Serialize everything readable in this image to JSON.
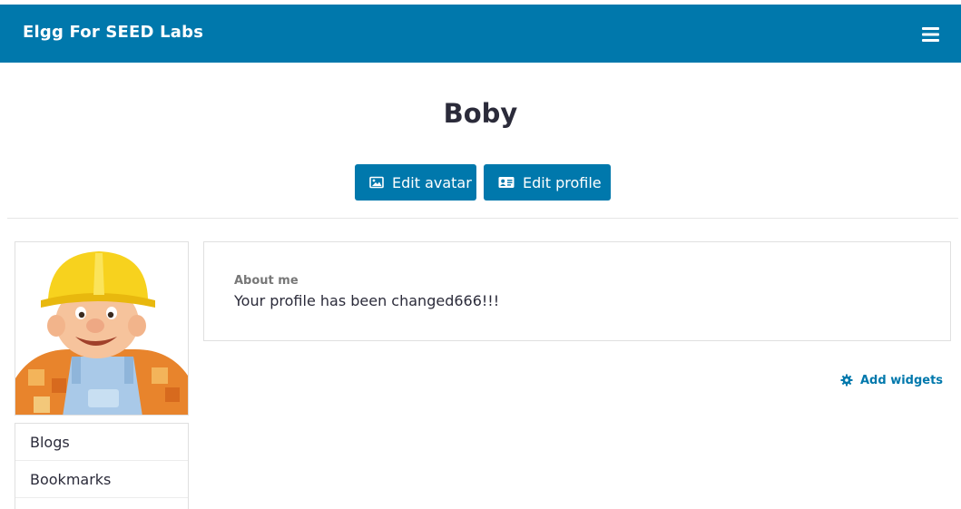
{
  "navbar": {
    "brand": "Elgg For SEED Labs",
    "menu_icon": "hamburger-menu-icon"
  },
  "profile": {
    "name": "Boby",
    "avatar_alt": "Bob the Builder avatar"
  },
  "actions": {
    "edit_avatar": "Edit avatar",
    "edit_avatar_icon": "image-icon",
    "edit_profile": "Edit profile",
    "edit_profile_icon": "id-card-icon"
  },
  "sidebar": {
    "items": [
      {
        "label": "Blogs"
      },
      {
        "label": "Bookmarks"
      }
    ]
  },
  "about": {
    "label": "About me",
    "value": "Your profile has been changed666!!!"
  },
  "widgets": {
    "add_label": "Add widgets",
    "icon": "gear-icon"
  },
  "colors": {
    "brand": "#0078ac",
    "text": "#2b2b3a",
    "muted": "#777777",
    "border": "#e0e0e0"
  }
}
